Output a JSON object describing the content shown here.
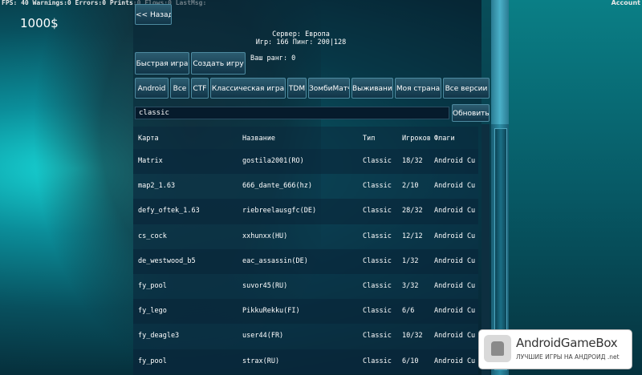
{
  "hud": {
    "debug_line": "FPS: 40 Warnings:0 Errors:0 Prints:0 Flows:0 LastMsg:",
    "account_label": "Account",
    "money": "1000$"
  },
  "nav": {
    "back_label": "<< Назад"
  },
  "server": {
    "server_line": "Сервер: Европа",
    "stats_line": "Игр: 166 Пинг: 200|128"
  },
  "actions": {
    "quick_game": "Быстрая игра",
    "create_game": "Создать игру",
    "rank_label": "Ваш ранг: 0"
  },
  "filters": [
    "Android",
    "Все",
    "CTF",
    "Классическая игра",
    "TDM",
    "ЗомбиМатч",
    "Выживание",
    "Моя страна",
    "Все версии"
  ],
  "search": {
    "value": "classic",
    "refresh_label": "Обновить"
  },
  "table": {
    "headers": [
      "Карта",
      "Название",
      "Тип",
      "Игроков",
      "Флаги"
    ],
    "rows": [
      [
        "Matrix",
        "gostila2001(RO)",
        "Classic",
        "18/32",
        "Android Cu"
      ],
      [
        "map2_1.63",
        "666_dante_666(hz)",
        "Classic",
        "2/10",
        "Android Cu"
      ],
      [
        "defy_oftek_1.63",
        "riebreelausgfc(DE)",
        "Classic",
        "28/32",
        "Android Cu"
      ],
      [
        "cs_cock",
        "xxhunxx(HU)",
        "Classic",
        "12/12",
        "Android Cu"
      ],
      [
        "de_westwood_b5",
        "eac_assassin(DE)",
        "Classic",
        "1/32",
        "Android Cu"
      ],
      [
        "fy_pool",
        "suvor45(RU)",
        "Classic",
        "3/32",
        "Android Cu"
      ],
      [
        "fy_lego",
        "PikkuRekku(FI)",
        "Classic",
        "6/6",
        "Android Cu"
      ],
      [
        "fy_deagle3",
        "user44(FR)",
        "Classic",
        "10/32",
        "Android Cu"
      ],
      [
        "fy_pool",
        "strax(RU)",
        "Classic",
        "6/10",
        "Android Cu"
      ]
    ]
  },
  "watermark": {
    "title": "AndroidGameBox",
    "subtitle": "ЛУЧШИЕ ИГРЫ НА АНДРОИД .net"
  }
}
